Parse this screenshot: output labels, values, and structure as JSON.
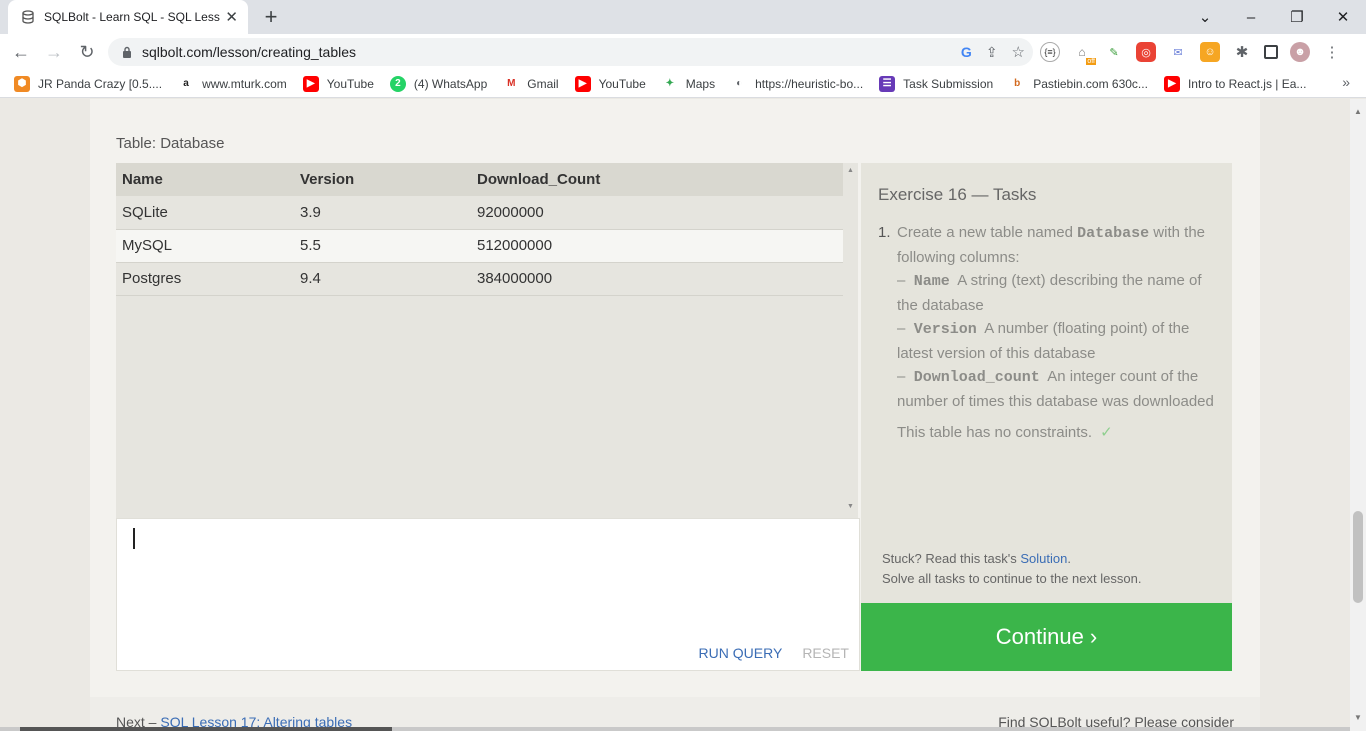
{
  "browser": {
    "tab_title": "SQLBolt - Learn SQL - SQL Lesson",
    "tab_close": "✕",
    "new_tab": "+",
    "url": "sqlbolt.com/lesson/creating_tables",
    "window_controls": {
      "chevron": "⌄",
      "minimize": "–",
      "restore": "❐",
      "close": "✕"
    },
    "nav": {
      "back": "←",
      "forward": "→",
      "reload": "↻"
    },
    "extension_badge": "off"
  },
  "bookmarks": [
    {
      "label": "JR Panda Crazy [0.5....",
      "icon": "panda-icon",
      "color": "#f08a24"
    },
    {
      "label": "www.mturk.com",
      "icon": "amazon-icon",
      "color": "#222222"
    },
    {
      "label": "YouTube",
      "icon": "youtube-icon",
      "color": "#ff0000"
    },
    {
      "label": "(4) WhatsApp",
      "icon": "whatsapp-icon",
      "color": "#25d366"
    },
    {
      "label": "Gmail",
      "icon": "gmail-icon",
      "color": "#d93025"
    },
    {
      "label": "YouTube",
      "icon": "youtube-icon",
      "color": "#ff0000"
    },
    {
      "label": "Maps",
      "icon": "maps-icon",
      "color": "#34a853"
    },
    {
      "label": "https://heuristic-bo...",
      "icon": "globe-icon",
      "color": "#5f6368"
    },
    {
      "label": "Task Submission",
      "icon": "form-icon",
      "color": "#673ab7"
    },
    {
      "label": "Pastiebin.com 630c...",
      "icon": "pastiebin-icon",
      "color": "#d2691e"
    },
    {
      "label": "Intro to React.js | Ea...",
      "icon": "youtube-icon",
      "color": "#ff0000"
    }
  ],
  "bookmarks_more": "»",
  "lesson": {
    "table_caption": "Table: Database",
    "columns": [
      "Name",
      "Version",
      "Download_Count"
    ],
    "rows": [
      [
        "SQLite",
        "3.9",
        "92000000"
      ],
      [
        "MySQL",
        "5.5",
        "512000000"
      ],
      [
        "Postgres",
        "9.4",
        "384000000"
      ]
    ],
    "run_label": "RUN QUERY",
    "reset_label": "RESET",
    "tasks_title": "Exercise 16 — Tasks",
    "task_number": "1.",
    "task_intro_a": "Create a new table named ",
    "task_table_name": "Database",
    "task_intro_b": " with the following columns:",
    "col_name_code": "Name",
    "col_name_desc": "A string (text) describing the name of the database",
    "col_version_code": "Version",
    "col_version_desc": "A number (floating point) of the latest version of this database",
    "col_download_code": "Download_count",
    "col_download_desc": "An integer count of the number of times this database was downloaded",
    "dash": "–",
    "constraint_text": "This table has no constraints.",
    "check_mark": "✓",
    "stuck_prefix": "Stuck? Read this task's ",
    "solution_link": "Solution",
    "stuck_suffix": ".",
    "solve_all": "Solve all tasks to continue to the next lesson.",
    "continue_label": "Continue ›",
    "next_prefix": "Next – ",
    "next_link": "SQL Lesson 17: Altering tables",
    "useful_text": "Find SQLBolt useful? Please consider"
  }
}
